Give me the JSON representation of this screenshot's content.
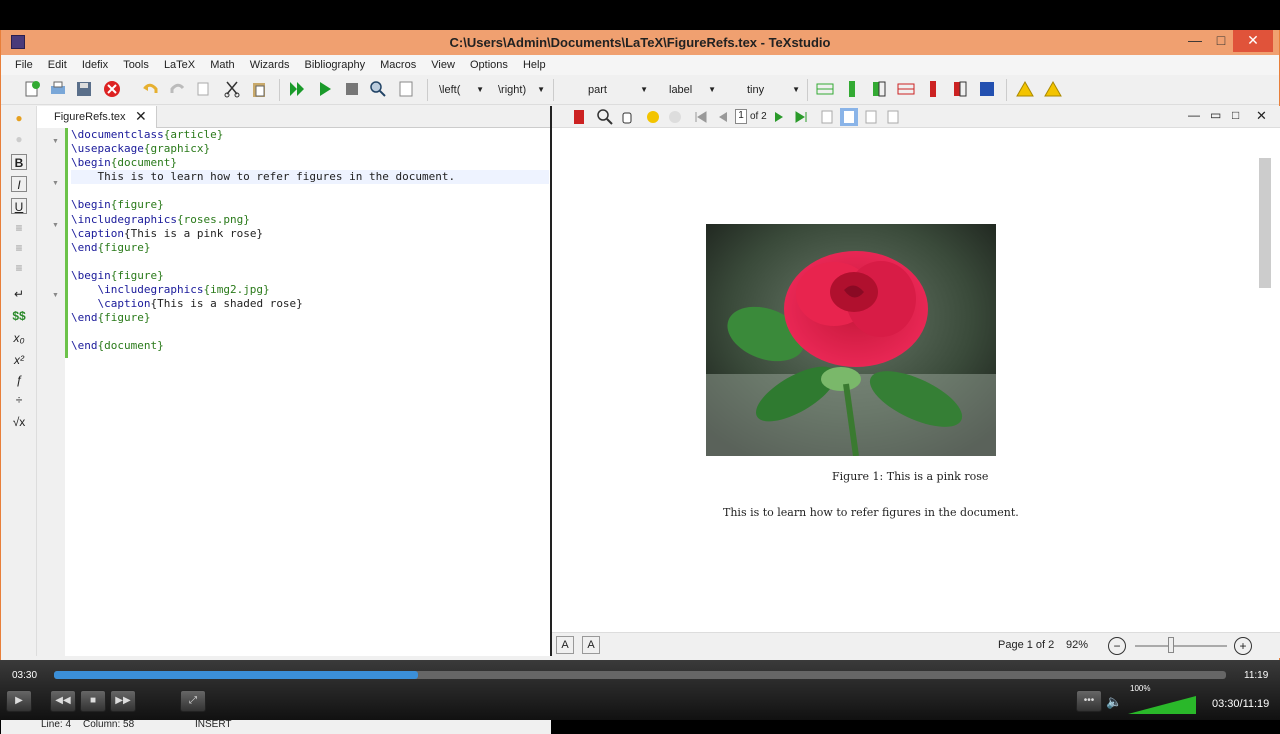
{
  "window": {
    "title": "C:\\Users\\Admin\\Documents\\LaTeX\\FigureRefs.tex - TeXstudio"
  },
  "menu": [
    "File",
    "Edit",
    "Idefix",
    "Tools",
    "LaTeX",
    "Math",
    "Wizards",
    "Bibliography",
    "Macros",
    "View",
    "Options",
    "Help"
  ],
  "toolbar": {
    "left_sel": "\\left(",
    "right_sel": "\\right)",
    "struct_sel": "part",
    "label_sel": "label",
    "size_sel": "tiny"
  },
  "tab": {
    "filename": "FigureRefs.tex"
  },
  "code": [
    [
      {
        "t": "\\documentclass",
        "c": "cmd"
      },
      {
        "t": "{article}",
        "c": "arg"
      }
    ],
    [
      {
        "t": "\\usepackage",
        "c": "cmd"
      },
      {
        "t": "{graphicx}",
        "c": "arg"
      }
    ],
    [
      {
        "t": "\\begin",
        "c": "cmd"
      },
      {
        "t": "{document}",
        "c": "arg"
      }
    ],
    [
      {
        "t": "    This is to learn how to refer figures in the document.",
        "c": "plain"
      }
    ],
    [],
    [
      {
        "t": "\\begin",
        "c": "cmd"
      },
      {
        "t": "{figure}",
        "c": "arg"
      }
    ],
    [
      {
        "t": "\\includegraphics",
        "c": "cmd"
      },
      {
        "t": "{roses.png}",
        "c": "arg"
      }
    ],
    [
      {
        "t": "\\caption",
        "c": "cmd"
      },
      {
        "t": "{This is a pink rose}",
        "c": "plain"
      }
    ],
    [
      {
        "t": "\\end",
        "c": "cmd"
      },
      {
        "t": "{figure}",
        "c": "arg"
      }
    ],
    [],
    [
      {
        "t": "\\begin",
        "c": "cmd"
      },
      {
        "t": "{figure}",
        "c": "arg"
      }
    ],
    [
      {
        "t": "    \\includegraphics",
        "c": "cmd"
      },
      {
        "t": "{img2.jpg}",
        "c": "arg"
      }
    ],
    [
      {
        "t": "    \\caption",
        "c": "cmd"
      },
      {
        "t": "{This is a shaded rose}",
        "c": "plain"
      }
    ],
    [
      {
        "t": "\\end",
        "c": "cmd"
      },
      {
        "t": "{figure}",
        "c": "arg"
      }
    ],
    [],
    [
      {
        "t": "\\end",
        "c": "cmd"
      },
      {
        "t": "{document}",
        "c": "arg"
      }
    ]
  ],
  "status": {
    "line": "Line: 4",
    "column": "Column: 58",
    "mode": "INSERT"
  },
  "viewer": {
    "page_num": "1",
    "page_of": "of 2",
    "caption": "Figure 1: This is a pink rose",
    "body": "This is to learn how to refer figures in the document.",
    "page_status": "Page 1 of 2",
    "zoom": "92%"
  },
  "player": {
    "current": "03:30",
    "total": "11:19",
    "combined": "03:30/11:19",
    "progress": 0.311,
    "volume": "100%"
  }
}
